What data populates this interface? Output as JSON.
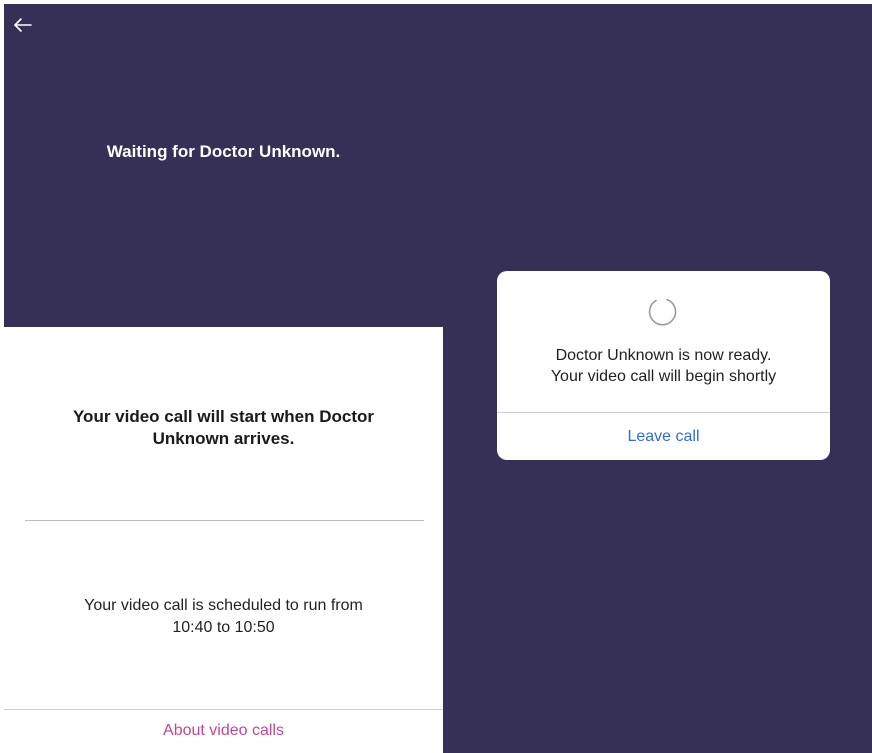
{
  "left_screen": {
    "waiting_message": "Waiting for Doctor Unknown.",
    "start_info_line1": "Your video call will start when Doctor",
    "start_info_line2": "Unknown arrives.",
    "schedule_line1": "Your video call is scheduled to run from",
    "schedule_line2": "10:40 to 10:50",
    "about_link": "About video calls",
    "back_icon": "arrow-left-icon"
  },
  "right_screen": {
    "dialog": {
      "spinner_icon": "loading-spinner-icon",
      "ready_line1": "Doctor Unknown is now ready.",
      "ready_line2": "Your video call will begin shortly",
      "leave_button": "Leave call"
    }
  },
  "colors": {
    "header_bg": "#363056",
    "link_pink": "#c0469a",
    "button_blue": "#2e6fd6",
    "text_dark": "#1a1a1a"
  }
}
